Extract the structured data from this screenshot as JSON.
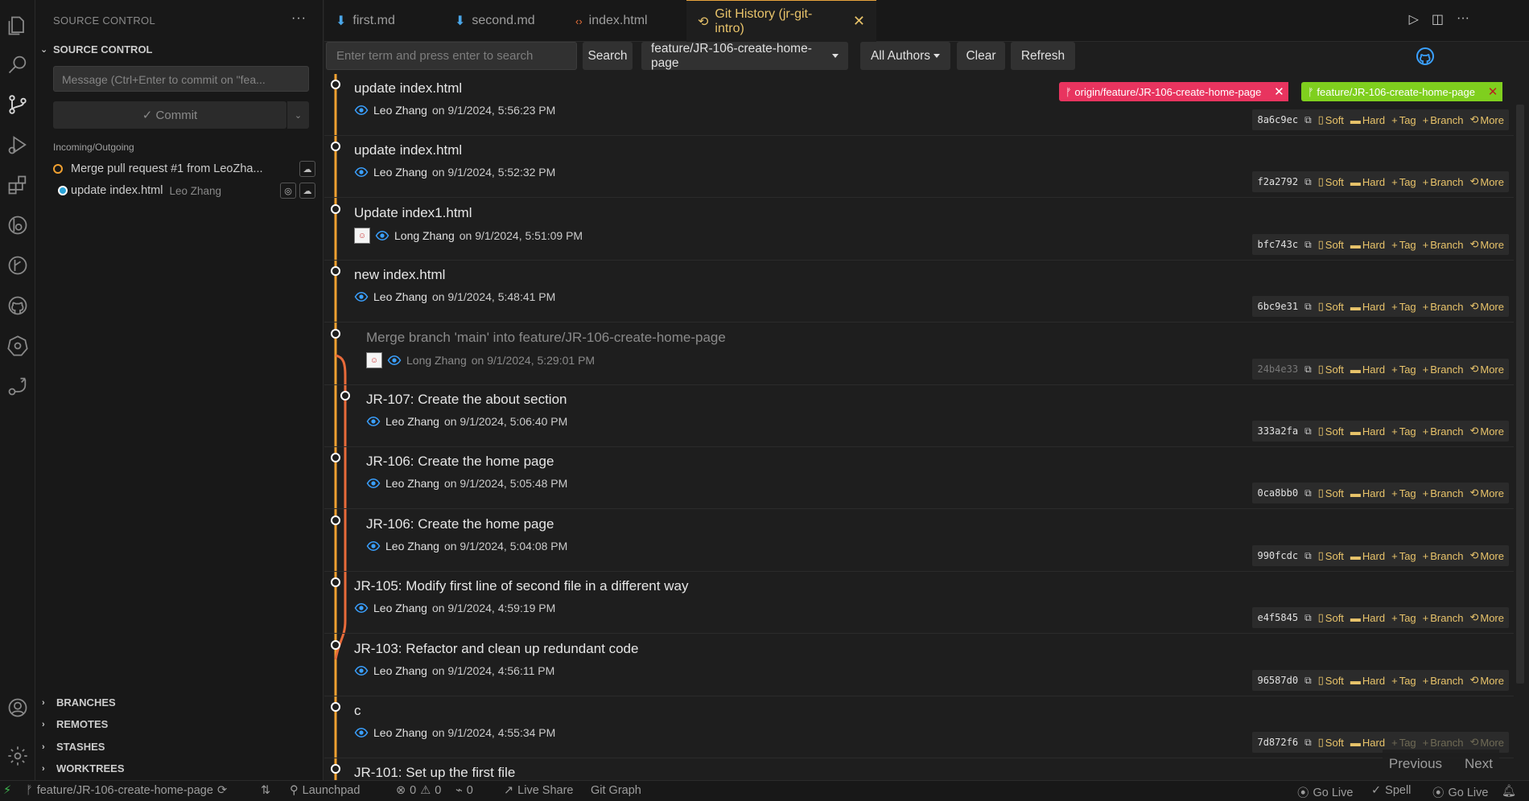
{
  "sidebar": {
    "title": "SOURCE CONTROL",
    "section": "SOURCE CONTROL",
    "message_placeholder": "Message (Ctrl+Enter to commit on \"fea...",
    "commit_label": "✓ Commit",
    "incoming_label": "Incoming/Outgoing",
    "incoming": [
      {
        "text": "Merge pull request #1 from LeoZha...",
        "author": ""
      },
      {
        "text": "update index.html",
        "author": "Leo Zhang"
      }
    ],
    "bottom_sections": [
      "BRANCHES",
      "REMOTES",
      "STASHES",
      "WORKTREES"
    ]
  },
  "tabs": [
    {
      "label": "first.md",
      "icon": "download-arrow-icon"
    },
    {
      "label": "second.md",
      "icon": "download-arrow-icon"
    },
    {
      "label": "index.html",
      "icon": "code-brackets-icon"
    },
    {
      "label": "Git History (jr-git-intro)",
      "icon": "history-icon",
      "active": true
    }
  ],
  "toolbar": {
    "search_placeholder": "Enter term and press enter to search",
    "search_button": "Search",
    "branch_dropdown": "feature/JR-106-create-home-page",
    "authors_dropdown": "All Authors",
    "clear_button": "Clear",
    "refresh_button": "Refresh"
  },
  "badges": {
    "remote": "origin/feature/JR-106-create-home-page",
    "local": "feature/JR-106-create-home-page",
    "remote_color": "#e8345f",
    "local_color": "#7fcf1e"
  },
  "actions": {
    "soft": "Soft",
    "hard": "Hard",
    "tag": "Tag",
    "branch": "Branch",
    "more": "More"
  },
  "commits": [
    {
      "title": "update index.html",
      "author": "Leo Zhang",
      "date": "on 9/1/2024, 5:56:23 PM",
      "hash": "8a6c9ec"
    },
    {
      "title": "update index.html",
      "author": "Leo Zhang",
      "date": "on 9/1/2024, 5:52:32 PM",
      "hash": "f2a2792"
    },
    {
      "title": "Update index1.html",
      "author": "Long Zhang",
      "date": "on 9/1/2024, 5:51:09 PM",
      "hash": "bfc743c"
    },
    {
      "title": "new index.html",
      "author": "Leo Zhang",
      "date": "on 9/1/2024, 5:48:41 PM",
      "hash": "6bc9e31"
    },
    {
      "title": "Merge branch 'main' into feature/JR-106-create-home-page",
      "author": "Long Zhang",
      "date": "on 9/1/2024, 5:29:01 PM",
      "hash": "24b4e33"
    },
    {
      "title": "JR-107: Create the about section",
      "author": "Leo Zhang",
      "date": "on 9/1/2024, 5:06:40 PM",
      "hash": "333a2fa"
    },
    {
      "title": "JR-106: Create the home page",
      "author": "Leo Zhang",
      "date": "on 9/1/2024, 5:05:48 PM",
      "hash": "0ca8bb0"
    },
    {
      "title": "JR-106: Create the home page",
      "author": "Leo Zhang",
      "date": "on 9/1/2024, 5:04:08 PM",
      "hash": "990fcdc"
    },
    {
      "title": "JR-105: Modify first line of second file in a different way",
      "author": "Leo Zhang",
      "date": "on 9/1/2024, 4:59:19 PM",
      "hash": "e4f5845"
    },
    {
      "title": "JR-103: Refactor and clean up redundant code",
      "author": "Leo Zhang",
      "date": "on 9/1/2024, 4:56:11 PM",
      "hash": "96587d0"
    },
    {
      "title": "c",
      "author": "Leo Zhang",
      "date": "on 9/1/2024, 4:55:34 PM",
      "hash": "7d872f6"
    },
    {
      "title": "JR-101: Set up the first file",
      "author": "",
      "date": "",
      "hash": ""
    }
  ],
  "pager": {
    "previous": "Previous",
    "next": "Next"
  },
  "status": {
    "branch": "feature/JR-106-create-home-page",
    "launchpad": "Launchpad",
    "problems": "0",
    "warnings": "0",
    "ports": "0",
    "live_share": "Live Share",
    "git_graph": "Git Graph",
    "go_live_1": "Go Live",
    "spell": "Spell",
    "go_live_2": "Go Live"
  },
  "colors": {
    "accent": "#e8c36a",
    "graph_main": "#f0a030",
    "graph_branch": "#e86a3a"
  }
}
